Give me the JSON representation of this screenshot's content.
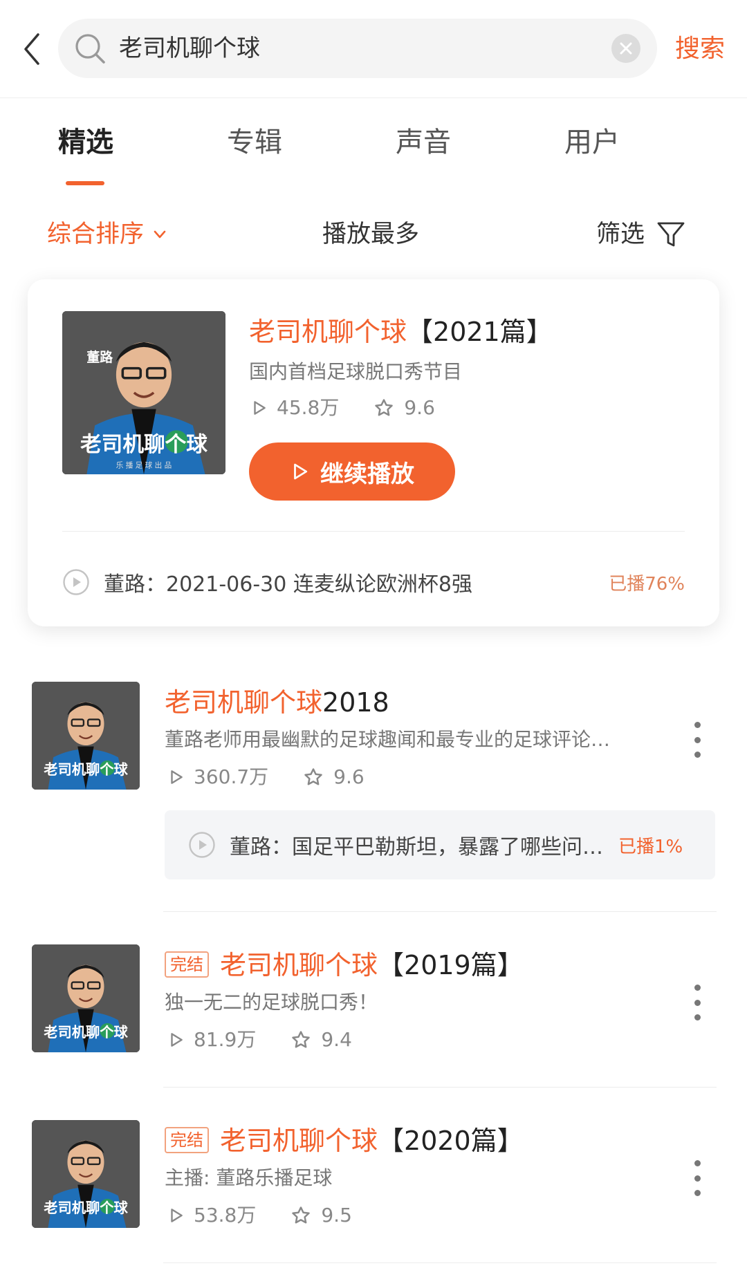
{
  "search": {
    "query": "老司机聊个球",
    "button": "搜索"
  },
  "tabs": [
    {
      "label": "精选",
      "active": true
    },
    {
      "label": "专辑",
      "active": false
    },
    {
      "label": "声音",
      "active": false
    },
    {
      "label": "用户",
      "active": false
    }
  ],
  "sort": {
    "main": "综合排序",
    "most_played": "播放最多",
    "filter": "筛选"
  },
  "featured": {
    "title_accent": "老司机聊个球",
    "title_rest": "【2021篇】",
    "desc": "国内首档足球脱口秀节目",
    "plays": "45.8万",
    "rating": "9.6",
    "button": "继续播放",
    "cover_text": "老司机聊个球",
    "cover_name": "董路",
    "cover_sub": "乐 播 足 球 出 品",
    "episode": "董路：2021-06-30 连麦纵论欧洲杯8强",
    "progress": "已播76%"
  },
  "items": [
    {
      "title_accent": "老司机聊个球",
      "title_rest": "2018",
      "badge": "",
      "desc": "董路老师用最幽默的足球趣闻和最专业的足球评论…",
      "plays": "360.7万",
      "rating": "9.6",
      "episode": "董路：国足平巴勒斯坦，暴露了哪些问…",
      "progress": "已播1%"
    },
    {
      "title_accent": "老司机聊个球",
      "title_rest": "【2019篇】",
      "badge": "完结",
      "desc": "独一无二的足球脱口秀！",
      "plays": "81.9万",
      "rating": "9.4"
    },
    {
      "title_accent": "老司机聊个球",
      "title_rest": "【2020篇】",
      "badge": "完结",
      "desc": "主播: 董路乐播足球",
      "plays": "53.8万",
      "rating": "9.5"
    }
  ],
  "colors": {
    "accent": "#f2622e",
    "progress": "#e0835a"
  }
}
